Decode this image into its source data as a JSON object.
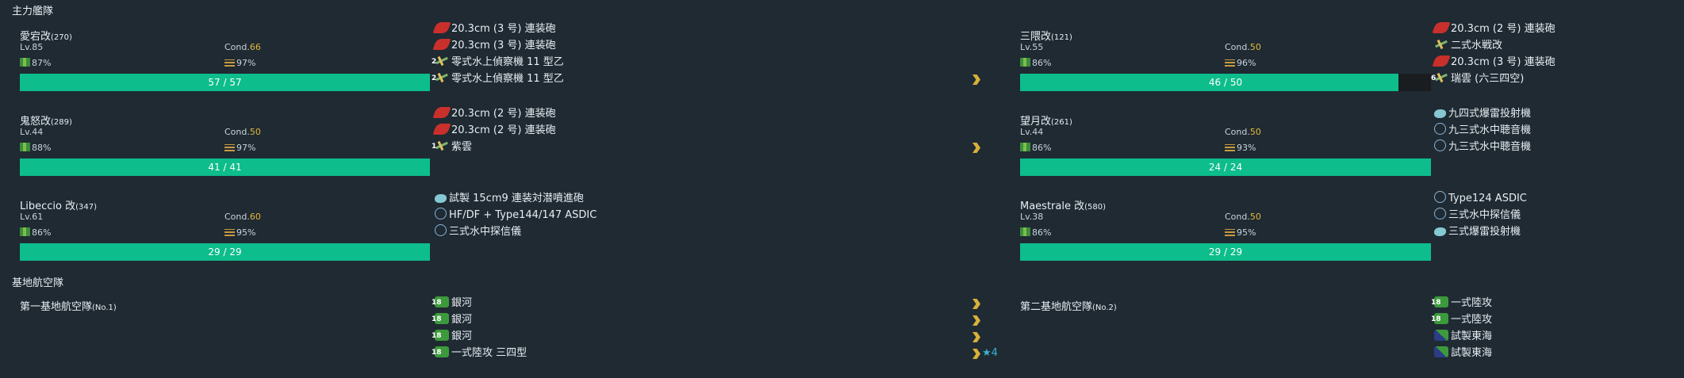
{
  "sections": {
    "main_fleet": "主力艦隊",
    "base_air": "基地航空隊"
  },
  "ships": [
    {
      "name": "愛宕改",
      "num": "(270)",
      "lv": "Lv.85",
      "cond_label": "Cond.",
      "cond": "66",
      "fuel": "87%",
      "ammo": "97%",
      "hp": "57 / 57",
      "hp_ratio": 1.0,
      "equips": [
        {
          "icon": "gun-icon",
          "text": "20.3cm (3 号) 連装砲"
        },
        {
          "icon": "gun-icon",
          "text": "20.3cm (3 号) 連装砲"
        },
        {
          "icon": "seaplane-icon",
          "badge": "2",
          "text": "零式水上偵察機 11 型乙"
        },
        {
          "icon": "seaplane-icon",
          "badge": "2",
          "text": "零式水上偵察機 11 型乙"
        }
      ]
    },
    {
      "name": "三隈改",
      "num": "(121)",
      "lv": "Lv.55",
      "cond_label": "Cond.",
      "cond": "50",
      "fuel": "86%",
      "ammo": "96%",
      "hp": "46 / 50",
      "hp_ratio": 0.92,
      "equips": [
        {
          "icon": "gun-icon",
          "text": "20.3cm (2 号) 連装砲"
        },
        {
          "icon": "seaplane-icon",
          "text": "二式水戦改"
        },
        {
          "icon": "gun-icon",
          "text": "20.3cm (3 号) 連装砲"
        },
        {
          "icon": "seaplane-icon",
          "badge": "6",
          "text": "瑞雲 (六三四空)"
        }
      ]
    },
    {
      "name": "鬼怒改",
      "num": "(289)",
      "lv": "Lv.44",
      "cond_label": "Cond.",
      "cond": "50",
      "fuel": "88%",
      "ammo": "97%",
      "hp": "41 / 41",
      "hp_ratio": 1.0,
      "equips": [
        {
          "icon": "gun-icon",
          "text": "20.3cm (2 号) 連装砲"
        },
        {
          "icon": "gun-icon",
          "text": "20.3cm (2 号) 連装砲"
        },
        {
          "icon": "seaplane-icon",
          "badge": "1",
          "text": "紫雲"
        }
      ]
    },
    {
      "name": "望月改",
      "num": "(261)",
      "lv": "Lv.44",
      "cond_label": "Cond.",
      "cond": "50",
      "fuel": "86%",
      "ammo": "93%",
      "hp": "24 / 24",
      "hp_ratio": 1.0,
      "equips": [
        {
          "icon": "depth-charge-icon",
          "text": "九四式爆雷投射機"
        },
        {
          "icon": "sonar-icon",
          "text": "九三式水中聴音機"
        },
        {
          "icon": "sonar-icon",
          "text": "九三式水中聴音機"
        }
      ]
    },
    {
      "name": "Libeccio 改",
      "num": "(347)",
      "lv": "Lv.61",
      "cond_label": "Cond.",
      "cond": "60",
      "fuel": "86%",
      "ammo": "95%",
      "hp": "29 / 29",
      "hp_ratio": 1.0,
      "equips": [
        {
          "icon": "depth-charge-icon",
          "text": "試製 15cm9 連装対潜噴進砲"
        },
        {
          "icon": "sonar-icon",
          "text": "HF/DF + Type144/147 ASDIC"
        },
        {
          "icon": "sonar-icon",
          "text": "三式水中探信儀"
        }
      ]
    },
    {
      "name": "Maestrale 改",
      "num": "(580)",
      "lv": "Lv.38",
      "cond_label": "Cond.",
      "cond": "50",
      "fuel": "86%",
      "ammo": "95%",
      "hp": "29 / 29",
      "hp_ratio": 1.0,
      "equips": [
        {
          "icon": "sonar-icon",
          "text": "Type124 ASDIC"
        },
        {
          "icon": "sonar-icon",
          "text": "三式水中探信儀"
        },
        {
          "icon": "depth-charge-icon",
          "text": "三式爆雷投射機"
        }
      ]
    }
  ],
  "air_corps": [
    {
      "name": "第一基地航空隊",
      "num": "(No.1)",
      "equips": [
        {
          "icon": "bomber-icon",
          "badge": "18",
          "text": "銀河"
        },
        {
          "icon": "bomber-icon",
          "badge": "18",
          "text": "銀河"
        },
        {
          "icon": "bomber-icon",
          "badge": "18",
          "text": "銀河"
        },
        {
          "icon": "bomber-icon",
          "badge": "18",
          "text": "一式陸攻 三四型"
        }
      ],
      "star": "★4"
    },
    {
      "name": "第二基地航空隊",
      "num": "(No.2)",
      "equips": [
        {
          "icon": "bomber-icon",
          "badge": "18",
          "text": "一式陸攻"
        },
        {
          "icon": "bomber-icon",
          "badge": "18",
          "text": "一式陸攻"
        },
        {
          "icon": "torpedo-bomber-icon",
          "text": "試製東海"
        },
        {
          "icon": "torpedo-bomber-icon",
          "text": "試製東海"
        }
      ]
    }
  ]
}
